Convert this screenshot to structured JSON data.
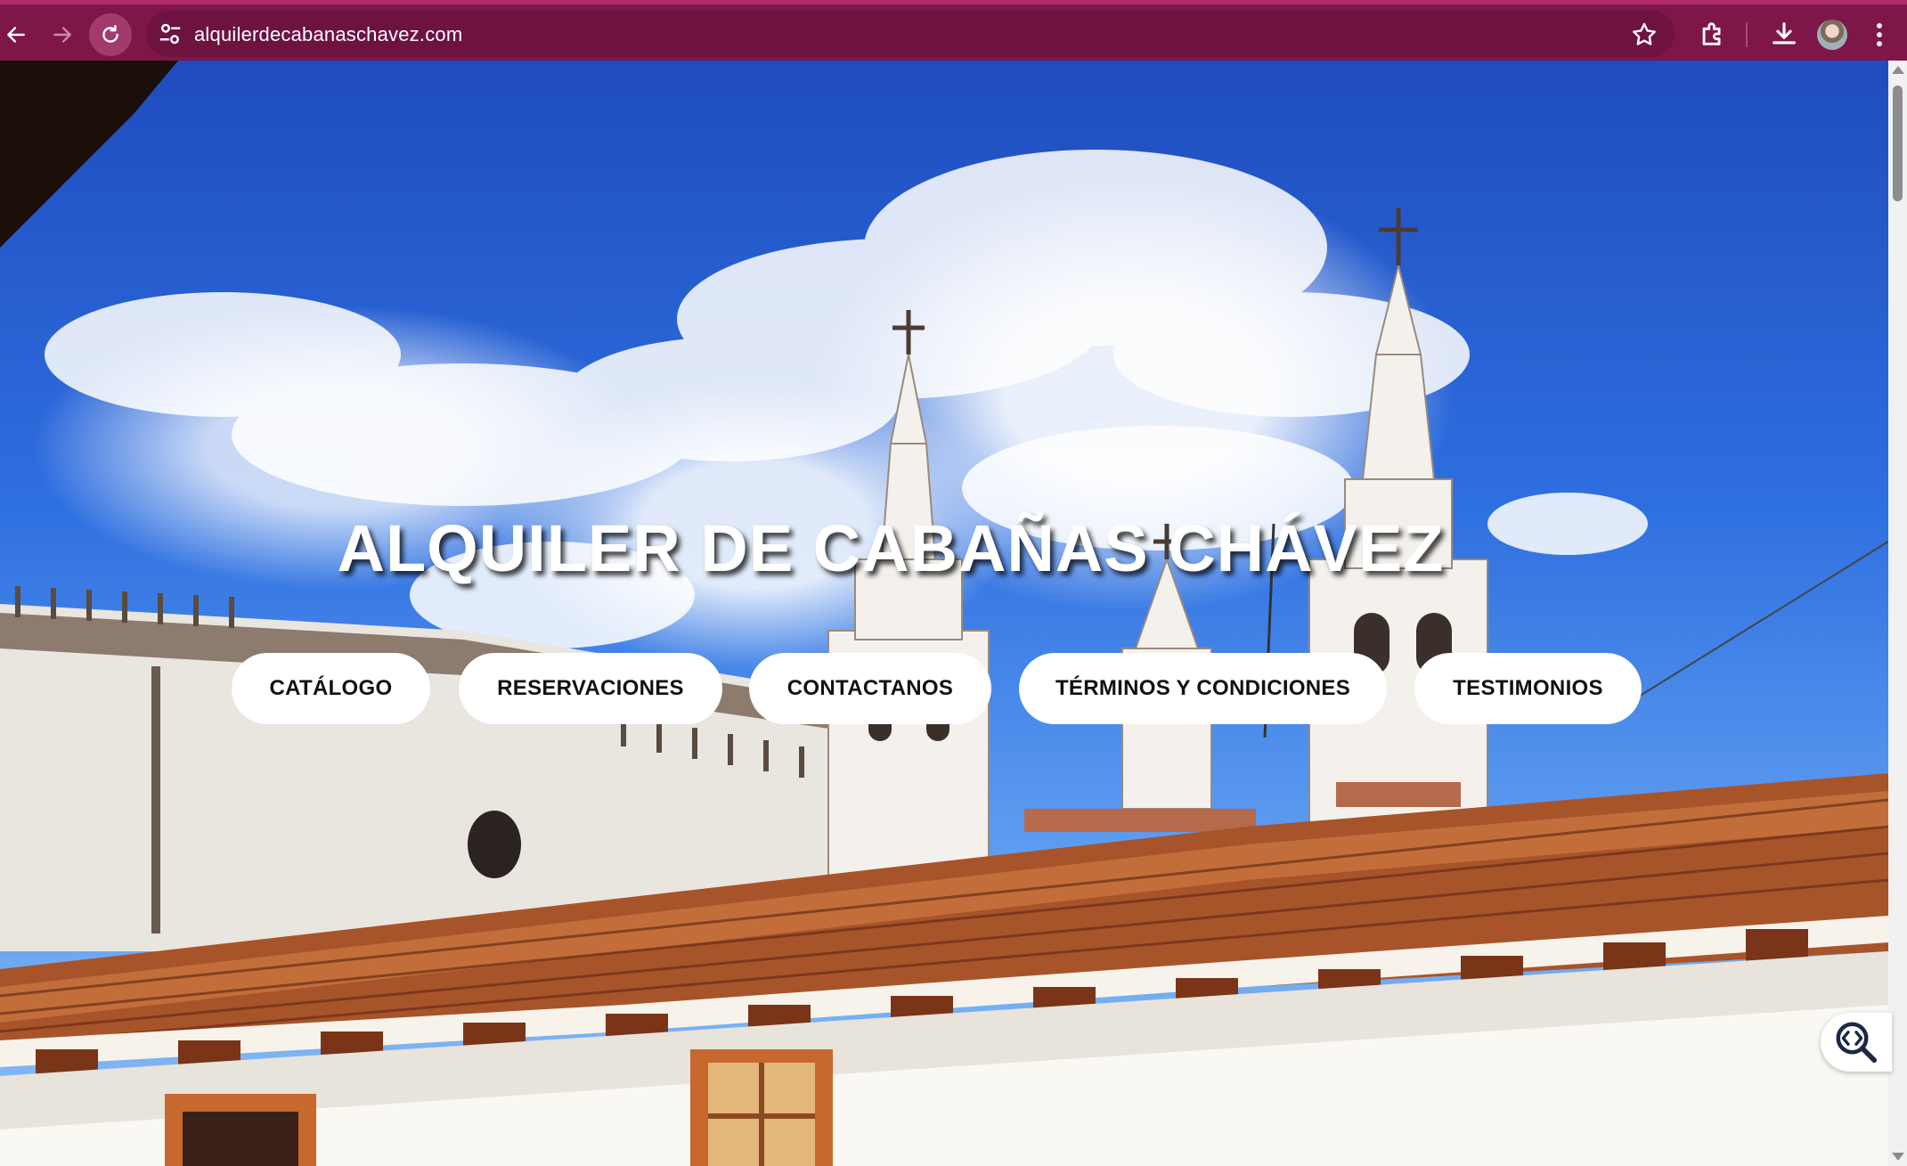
{
  "browser": {
    "url": "alquilerdecabanaschavez.com",
    "icons": [
      "back-arrow-icon",
      "forward-arrow-icon",
      "reload-icon",
      "site-settings-icon",
      "bookmark-star-icon",
      "extensions-icon",
      "downloads-icon",
      "profile-avatar",
      "kebab-menu-icon"
    ],
    "theme_color": "#7e1748"
  },
  "hero": {
    "title": "ALQUILER DE CABAÑAS CHÁVEZ"
  },
  "nav": {
    "items": [
      {
        "label": "CATÁLOGO"
      },
      {
        "label": "RESERVACIONES"
      },
      {
        "label": "CONTACTANOS"
      },
      {
        "label": "TÉRMINOS Y CONDICIONES"
      },
      {
        "label": "TESTIMONIOS"
      }
    ]
  },
  "floating_tool": {
    "icon": "code-search-icon"
  }
}
